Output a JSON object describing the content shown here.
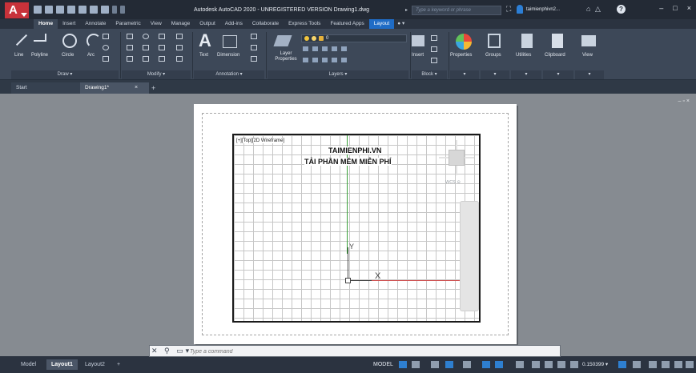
{
  "titlebar": {
    "logo_letter": "A",
    "title": "Autodesk AutoCAD 2020 - UNREGISTERED VERSION   Drawing1.dwg",
    "search_placeholder": "Type a keyword or phrase",
    "user": "taimienphivn2...",
    "window_controls": [
      "–",
      "□",
      "×"
    ]
  },
  "ribbon_tabs": [
    "Home",
    "Insert",
    "Annotate",
    "Parametric",
    "View",
    "Manage",
    "Output",
    "Add-ins",
    "Collaborate",
    "Express Tools",
    "Featured Apps",
    "Layout"
  ],
  "ribbon": {
    "draw": {
      "line": "Line",
      "polyline": "Polyline",
      "circle": "Circle",
      "arc": "Arc",
      "footer": "Draw ▾"
    },
    "modify": {
      "footer": "Modify ▾"
    },
    "annotation": {
      "text": "Text",
      "dimension": "Dimension",
      "footer": "Annotation ▾"
    },
    "layers": {
      "layer_properties": "Layer Properties",
      "current_layer": "0",
      "footer": "Layers ▾"
    },
    "block": {
      "insert": "Insert",
      "footer": "Block ▾"
    },
    "properties": "Properties",
    "groups": "Groups",
    "utilities": "Utilities",
    "clipboard": "Clipboard",
    "view": "View"
  },
  "file_tabs": {
    "start": "Start",
    "drawing": "Drawing1*",
    "close": "×",
    "add": "+"
  },
  "viewport": {
    "label": "[+][Top][2D Wireframe]",
    "title": "TAIMIENPHI.VN",
    "subtitle": "TẢI PHẦN MỀM MIỄN PHÍ",
    "ucs_y": "Y",
    "ucs_x": "X",
    "wcs": "WCS ⊝"
  },
  "command": {
    "placeholder": "Type a command"
  },
  "status": {
    "layout_tabs": [
      "Model",
      "Layout1",
      "Layout2",
      "+"
    ],
    "active_tab": "Layout1",
    "model": "MODEL",
    "scale": "0.150399 ▾"
  },
  "colors": {
    "accent": "#1f6cc6",
    "brand_red": "#c8323a"
  }
}
